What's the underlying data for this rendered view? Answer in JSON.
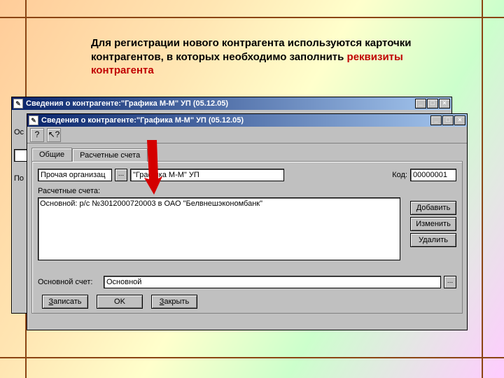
{
  "heading": {
    "part1": "Для регистрации нового контрагента используются карточки контрагентов, в которых необходимо заполнить ",
    "keyword": "реквизиты контрагента"
  },
  "window": {
    "title": "Сведения о контрагенте:\"Графика М-М\" УП (05.12.05)",
    "minimize": "_",
    "maximize": "□",
    "close": "×",
    "tool_help": "?",
    "tool_cursor": "↖?"
  },
  "tabs": {
    "general": "Общие",
    "accounts": "Расчетные счета"
  },
  "form": {
    "org_label": "Прочая организац",
    "ellipsis": "...",
    "org_name": "\"Графика М-М\" УП",
    "code_label": "Код:",
    "code_value": "00000001",
    "accounts_label": "Расчетные счета:",
    "account_entry": "Основной: р/с №3012000720003 в ОАО \"Белвнешэкономбанк\"",
    "main_account_label": "Основной счет:",
    "main_account_value": "Основной"
  },
  "side_buttons": {
    "add": "Добавить",
    "edit": "Изменить",
    "delete": "Удалить"
  },
  "bottom_buttons": {
    "write_u": "З",
    "write_rest": "аписать",
    "ok": "OK",
    "close_u": "З",
    "close_rest": "акрыть"
  },
  "back_labels": {
    "l1": "Ос",
    "l2": "П",
    "l3": "По"
  }
}
